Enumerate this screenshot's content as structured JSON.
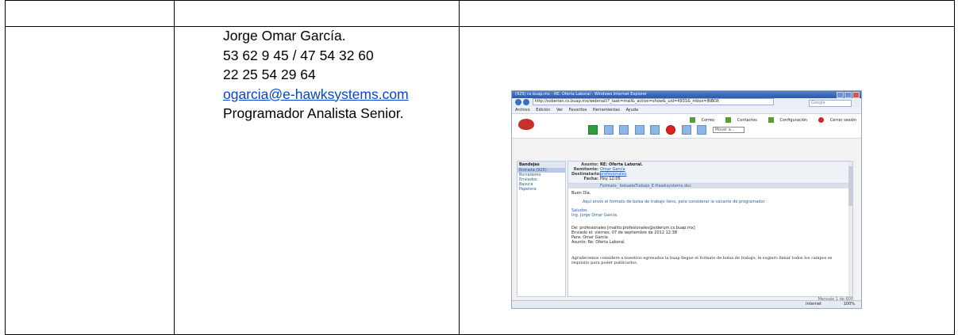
{
  "contact": {
    "name": "Jorge Omar García.",
    "phone1": "53 62 9 45 / 47 54 32 60",
    "phone2": "22 25 54 29 64",
    "email": "ogarcia@e-hawksystems.com",
    "role": "Programador Analista Senior."
  },
  "screenshot": {
    "window_title": "(925) cs buap.mx - RE: Oferta Laboral - Windows Internet Explorer",
    "url": "http://soberian.cs.buap.mx/webmail/?_task=mail&_action=show&_uid=4931&_mbox=INBOX",
    "search_placeholder": "Google",
    "menu": [
      "Archivo",
      "Edición",
      "Ver",
      "Favoritos",
      "Herramientas",
      "Ayuda"
    ],
    "top_links": [
      "Correo",
      "Contactos",
      "Configuración",
      "Cerrar sesión"
    ],
    "folder_header": "Bandejas",
    "folders": [
      "Entrada (925)",
      "Borradores",
      "Enviados",
      "Basura",
      "Papelera"
    ],
    "move_select": "Mover a...",
    "meta": [
      {
        "key": "Asunto:",
        "value": "RE: Oferta Laboral."
      },
      {
        "key": "Remitente:",
        "value": "Omar García"
      },
      {
        "key": "Destinatario:",
        "value": "profesionales"
      },
      {
        "key": "Fecha:",
        "value": "Hoy 12:05"
      }
    ],
    "attachment": "Formato_ bolsadeTrabajo_E-Hawksystems.doc",
    "body": {
      "greeting": "Buen Día.",
      "message": "Aquí envío el formato de bolsa de trabajo lleno, para considerar la vacante de programador.",
      "closing": "Saludos.",
      "signature": "Ing. Jorge Omar García.",
      "fwd_from": "De: profesionales [mailto:profesionales@siderum.cs.buap.mx]",
      "fwd_sent": "Enviado el: viernes, 07 de septiembre de 2012 12:38",
      "fwd_to": "Para: Omar García",
      "fwd_subject": "Asunto: Re: Oferta Laboral.",
      "fwd_text": "Agradecemos considere a nuestros egresados la buap llegue el formato de bolsa de trabajo, le sugiero llenar todos los campos es requisito para poder publicarlos."
    },
    "pager": "Mensaje 1 de 600",
    "status_zone": "Internet",
    "zoom": "100%"
  }
}
